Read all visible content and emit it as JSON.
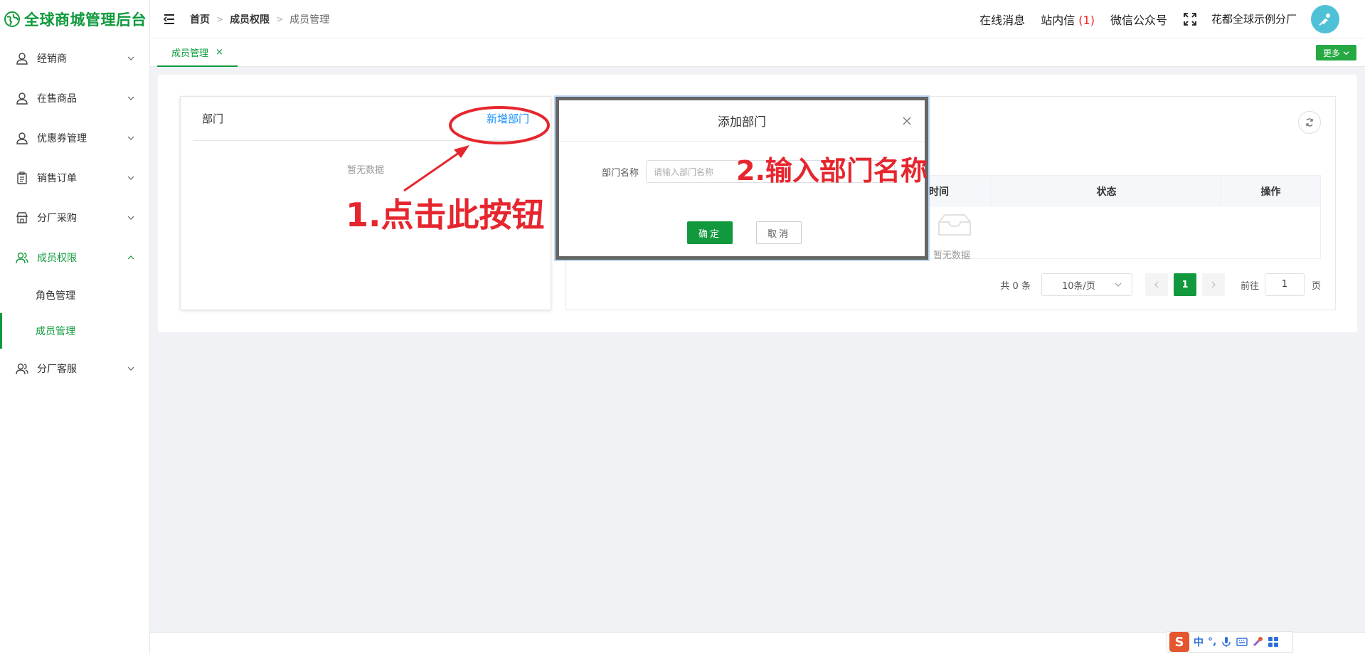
{
  "app": {
    "title": "全球商城管理后台"
  },
  "sidebar": {
    "items": [
      {
        "label": "经销商",
        "icon": "user-icon"
      },
      {
        "label": "在售商品",
        "icon": "user-icon"
      },
      {
        "label": "优惠券管理",
        "icon": "user-icon"
      },
      {
        "label": "销售订单",
        "icon": "clipboard-icon"
      },
      {
        "label": "分厂采购",
        "icon": "store-icon"
      },
      {
        "label": "成员权限",
        "icon": "users-icon",
        "expanded": true,
        "children": [
          {
            "label": "角色管理"
          },
          {
            "label": "成员管理",
            "active": true
          }
        ]
      },
      {
        "label": "分厂客服",
        "icon": "users-icon"
      }
    ]
  },
  "header": {
    "breadcrumb": [
      "首页",
      "成员权限",
      "成员管理"
    ],
    "online_msg": "在线消息",
    "inbox_label": "站内信",
    "inbox_count": "(1)",
    "wechat": "微信公众号",
    "branch": "花都全球示例分厂"
  },
  "tabs": [
    {
      "label": "成员管理",
      "close": "×"
    }
  ],
  "more_button": "更多",
  "dept_panel": {
    "title": "部门",
    "add_label": "新增部门",
    "empty": "暂无数据"
  },
  "member_table": {
    "columns": [
      "时间",
      "状态",
      "操作"
    ],
    "empty": "暂无数据"
  },
  "pager": {
    "total": "共 0 条",
    "page_size": "10条/页",
    "current": "1",
    "goto_label": "前往",
    "goto_value": "1",
    "page_suffix": "页"
  },
  "dialog": {
    "title": "添加部门",
    "field_label": "部门名称",
    "placeholder": "请输入部门名称",
    "ok": "确定",
    "cancel": "取消"
  },
  "annotations": {
    "step1": "1.点击此按钮",
    "step2": "2.输入部门名称"
  },
  "ime": {
    "mode": "中",
    "punct": "°,"
  },
  "colors": {
    "brand": "#0f9a3c",
    "link": "#1890ff",
    "annotation": "#e6262e"
  }
}
